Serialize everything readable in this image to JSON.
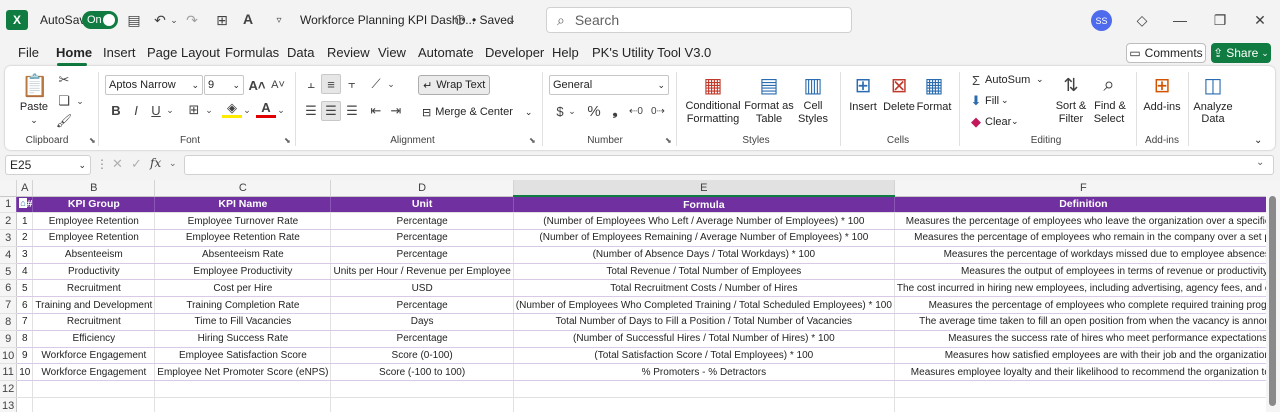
{
  "titlebar": {
    "autosave_label": "AutoSave",
    "autosave_state": "On",
    "file_name": "Workforce Planning KPI Dashb...",
    "saved_status": "• Saved",
    "search_placeholder": "Search",
    "user_initials": "SS"
  },
  "menu": {
    "items": [
      "File",
      "Home",
      "Insert",
      "Page Layout",
      "Formulas",
      "Data",
      "Review",
      "View",
      "Automate",
      "Developer",
      "Help",
      "PK's Utility Tool V3.0"
    ],
    "active": "Home",
    "comments_label": "Comments",
    "share_label": "Share"
  },
  "ribbon": {
    "clipboard": {
      "paste": "Paste",
      "label": "Clipboard"
    },
    "font": {
      "name": "Aptos Narrow",
      "size": "9",
      "bold": "B",
      "italic": "I",
      "underline": "U",
      "label": "Font"
    },
    "alignment": {
      "wrap": "Wrap Text",
      "merge": "Merge & Center",
      "label": "Alignment"
    },
    "number": {
      "format": "General",
      "label": "Number"
    },
    "styles": {
      "conditional": "Conditional",
      "conditional2": "Formatting",
      "format_table": "Format as",
      "format_table2": "Table",
      "cell_styles": "Cell",
      "cell_styles2": "Styles",
      "label": "Styles"
    },
    "cells": {
      "insert": "Insert",
      "delete": "Delete",
      "format": "Format",
      "label": "Cells"
    },
    "editing": {
      "autosum": "AutoSum",
      "fill": "Fill",
      "clear": "Clear",
      "sort": "Sort &",
      "sort2": "Filter",
      "find": "Find &",
      "find2": "Select",
      "label": "Editing"
    },
    "addins": {
      "addins": "Add-ins",
      "label": "Add-ins",
      "analyze": "Analyze",
      "analyze2": "Data"
    }
  },
  "formula_bar": {
    "name_box": "E25",
    "fx": "fx",
    "value": ""
  },
  "sheet": {
    "columns": [
      "A",
      "B",
      "C",
      "D",
      "E",
      "F"
    ],
    "selected_column": "E",
    "headers": [
      "#",
      "KPI Group",
      "KPI Name",
      "Unit",
      "Formula",
      "Definition"
    ],
    "rows": [
      [
        "1",
        "Employee Retention",
        "Employee Turnover Rate",
        "Percentage",
        "(Number of Employees Who Left / Average Number of Employees) * 100",
        "Measures the percentage of employees who leave the organization over a specific"
      ],
      [
        "2",
        "Employee Retention",
        "Employee Retention Rate",
        "Percentage",
        "(Number of Employees Remaining / Average Number of Employees) * 100",
        "Measures the percentage of employees who remain in the company over a set p"
      ],
      [
        "3",
        "Absenteeism",
        "Absenteeism Rate",
        "Percentage",
        "(Number of Absence Days / Total Workdays) * 100",
        "Measures the percentage of workdays missed due to employee absences"
      ],
      [
        "4",
        "Productivity",
        "Employee Productivity",
        "Units per Hour / Revenue per Employee",
        "Total Revenue / Total Number of Employees",
        "Measures the output of employees in terms of revenue or productivity."
      ],
      [
        "5",
        "Recruitment",
        "Cost per Hire",
        "USD",
        "Total Recruitment Costs / Number of Hires",
        "The cost incurred in hiring new employees, including advertising, agency fees, and c"
      ],
      [
        "6",
        "Training and Development",
        "Training Completion Rate",
        "Percentage",
        "(Number of Employees Who Completed Training / Total Scheduled Employees) * 100",
        "Measures the percentage of employees who complete required training progr"
      ],
      [
        "7",
        "Recruitment",
        "Time to Fill Vacancies",
        "Days",
        "Total Number of Days to Fill a Position / Total Number of Vacancies",
        "The average time taken to fill an open position from when the vacancy is annou"
      ],
      [
        "8",
        "Efficiency",
        "Hiring Success Rate",
        "Percentage",
        "(Number of Successful Hires / Total Number of Hires) * 100",
        "Measures the success rate of hires who meet performance expectations."
      ],
      [
        "9",
        "Workforce Engagement",
        "Employee Satisfaction Score",
        "Score (0-100)",
        "(Total Satisfaction Score / Total Employees) * 100",
        "Measures how satisfied employees are with their job and the organization"
      ],
      [
        "10",
        "Workforce Engagement",
        "Employee Net Promoter Score (eNPS)",
        "Score (-100 to 100)",
        "% Promoters - % Detractors",
        "Measures employee loyalty and their likelihood to recommend the organization to"
      ]
    ],
    "row_numbers": [
      "1",
      "2",
      "3",
      "4",
      "5",
      "6",
      "7",
      "8",
      "9",
      "10",
      "11",
      "12",
      "13"
    ]
  },
  "colors": {
    "accent": "#107c41",
    "header_fill": "#7030a0"
  }
}
